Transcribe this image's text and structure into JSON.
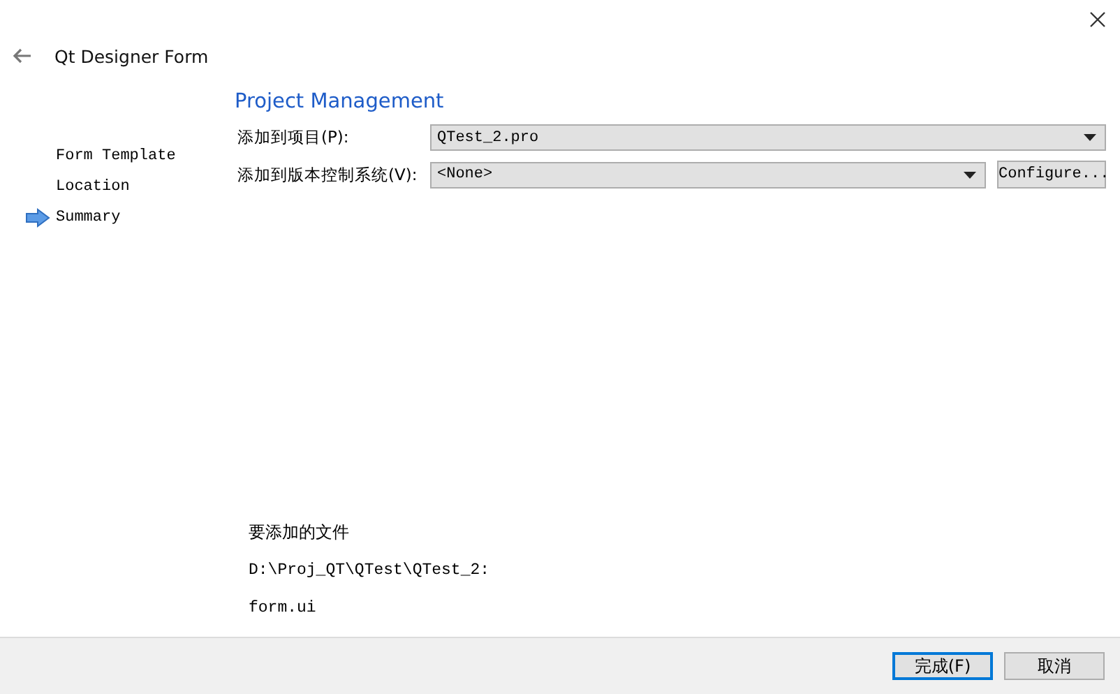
{
  "window": {
    "title": "Qt Designer Form"
  },
  "steps": [
    {
      "label": "Form Template",
      "selected": false
    },
    {
      "label": "Location",
      "selected": false
    },
    {
      "label": "Summary",
      "selected": true
    }
  ],
  "page": {
    "heading": "Project Management",
    "fields": [
      {
        "label": "添加到项目(P):",
        "value": "QTest_2.pro"
      },
      {
        "label": "添加到版本控制系统(V):",
        "value": "<None>",
        "button": "Configure..."
      }
    ],
    "files_heading": "要添加的文件",
    "path": "D:\\Proj_QT\\QTest\\QTest_2:",
    "files": [
      "form.ui"
    ]
  },
  "buttons": [
    {
      "label": "完成(F)",
      "default": true
    },
    {
      "label": "取消",
      "default": false
    }
  ]
}
